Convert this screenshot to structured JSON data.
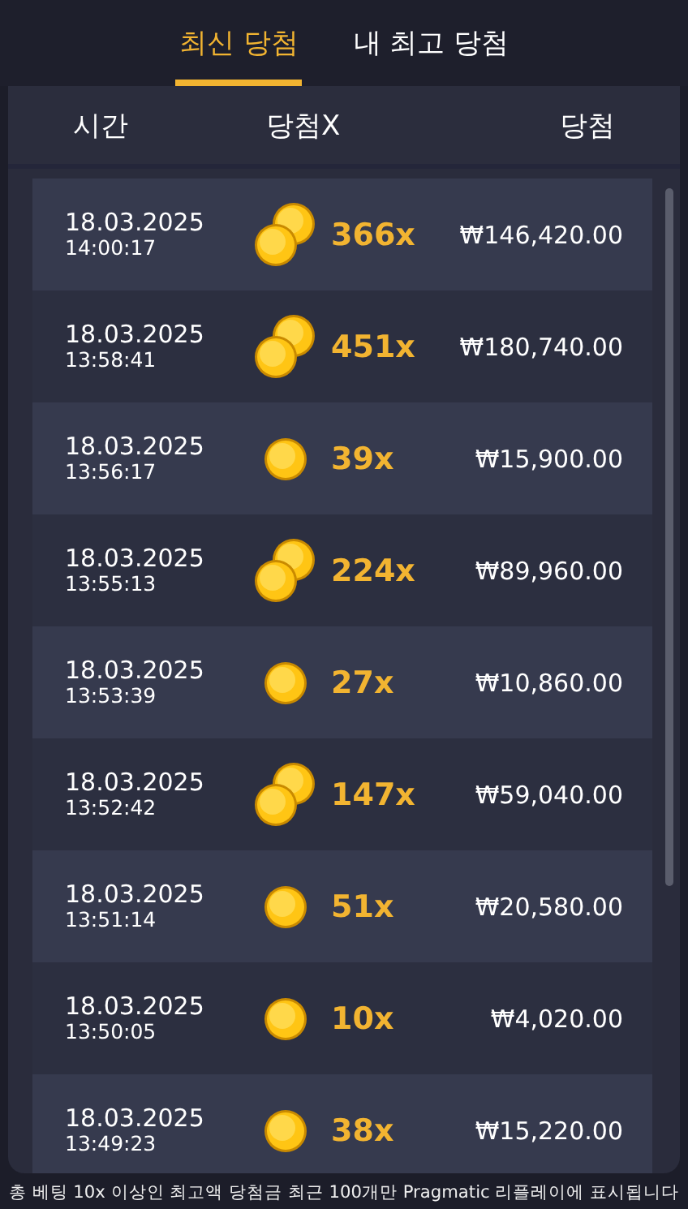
{
  "tabs": [
    {
      "label": "최신 당첨",
      "selected": true
    },
    {
      "label": "내 최고 당첨",
      "selected": false
    }
  ],
  "columns": [
    "시간",
    "당첨X",
    "당첨"
  ],
  "rows": [
    {
      "date": "18.03.2025",
      "time": "14:00:17",
      "kind": "double",
      "multiplier": "366x",
      "win": "₩146,420.00"
    },
    {
      "date": "18.03.2025",
      "time": "13:58:41",
      "kind": "double",
      "multiplier": "451x",
      "win": "₩180,740.00"
    },
    {
      "date": "18.03.2025",
      "time": "13:56:17",
      "kind": "single",
      "multiplier": "39x",
      "win": "₩15,900.00"
    },
    {
      "date": "18.03.2025",
      "time": "13:55:13",
      "kind": "double",
      "multiplier": "224x",
      "win": "₩89,960.00"
    },
    {
      "date": "18.03.2025",
      "time": "13:53:39",
      "kind": "single",
      "multiplier": "27x",
      "win": "₩10,860.00"
    },
    {
      "date": "18.03.2025",
      "time": "13:52:42",
      "kind": "double",
      "multiplier": "147x",
      "win": "₩59,040.00"
    },
    {
      "date": "18.03.2025",
      "time": "13:51:14",
      "kind": "single",
      "multiplier": "51x",
      "win": "₩20,580.00"
    },
    {
      "date": "18.03.2025",
      "time": "13:50:05",
      "kind": "single",
      "multiplier": "10x",
      "win": "₩4,020.00"
    },
    {
      "date": "18.03.2025",
      "time": "13:49:23",
      "kind": "single",
      "multiplier": "38x",
      "win": "₩15,220.00"
    }
  ],
  "footer": "총 베팅 10x 이상인 최고액 당첨금 최근 100개만 Pragmatic 리플레이에 표시됩니다"
}
